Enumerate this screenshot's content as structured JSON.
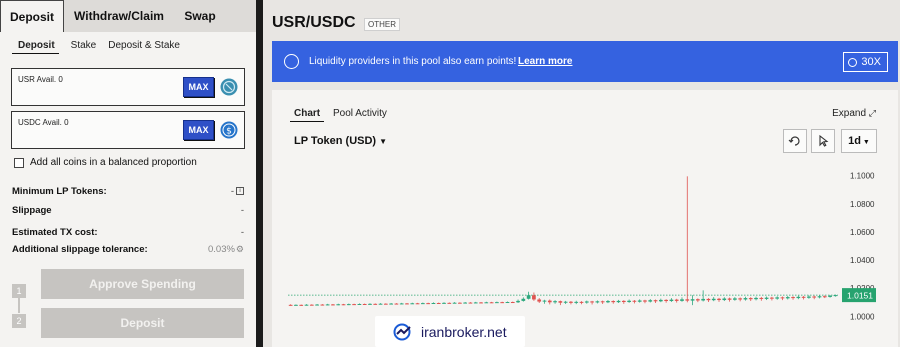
{
  "tabs": [
    "Deposit",
    "Withdraw/Claim",
    "Swap"
  ],
  "subtabs": [
    "Deposit",
    "Stake",
    "Deposit & Stake"
  ],
  "inputs": [
    {
      "label": "USR Avail. 0",
      "max": "MAX",
      "coin": "usr-coin-icon"
    },
    {
      "label": "USDC Avail. 0",
      "max": "MAX",
      "coin": "usdc-coin-icon"
    }
  ],
  "balanced_label": "Add all coins in a balanced proportion",
  "rows": {
    "min_lp": {
      "label": "Minimum LP Tokens:",
      "value": "-"
    },
    "slippage": {
      "label": "Slippage",
      "value": "-"
    },
    "tx_cost": {
      "label": "Estimated TX cost:",
      "value": "-"
    },
    "add_slip": {
      "label": "Additional slippage tolerance:",
      "value": "0.03%"
    }
  },
  "steps": [
    "1",
    "2"
  ],
  "buttons": {
    "approve": "Approve Spending",
    "deposit": "Deposit"
  },
  "pool": {
    "name": "USR/USDC",
    "tag": "OTHER"
  },
  "banner": {
    "text": "Liquidity providers in this pool also earn points!",
    "link": "Learn more",
    "multiplier": "30X"
  },
  "chart_panel": {
    "tabs": [
      "Chart",
      "Pool Activity"
    ],
    "expand": "Expand",
    "token": "LP Token (USD)",
    "timeframe": "1d"
  },
  "watermark": "iranbroker.net",
  "colors": {
    "up": "#2ea87e",
    "down": "#e0524f",
    "accent": "#3562e0",
    "current": "#27a36f"
  },
  "chart_data": {
    "type": "candlestick",
    "yticks": [
      "1.1000",
      "1.0800",
      "1.0600",
      "1.0400",
      "1.0200",
      "1.0000"
    ],
    "ylim": [
      0.996,
      1.104
    ],
    "current_value": "1.0151",
    "grid": false,
    "spike_high": 1.0995,
    "candles": [
      {
        "o": 1.0082,
        "c": 1.008,
        "h": 1.0086,
        "l": 1.0076
      },
      {
        "o": 1.008,
        "c": 1.0082,
        "h": 1.0085,
        "l": 1.0077
      },
      {
        "o": 1.0082,
        "c": 1.0079,
        "h": 1.0084,
        "l": 1.0075
      },
      {
        "o": 1.0079,
        "c": 1.0083,
        "h": 1.0087,
        "l": 1.0076
      },
      {
        "o": 1.0083,
        "c": 1.008,
        "h": 1.0086,
        "l": 1.0077
      },
      {
        "o": 1.008,
        "c": 1.0084,
        "h": 1.0088,
        "l": 1.0078
      },
      {
        "o": 1.0084,
        "c": 1.0081,
        "h": 1.0087,
        "l": 1.0077
      },
      {
        "o": 1.0081,
        "c": 1.0085,
        "h": 1.0089,
        "l": 1.0079
      },
      {
        "o": 1.0085,
        "c": 1.0082,
        "h": 1.0088,
        "l": 1.0078
      },
      {
        "o": 1.0082,
        "c": 1.0086,
        "h": 1.009,
        "l": 1.0079
      },
      {
        "o": 1.0086,
        "c": 1.0083,
        "h": 1.0089,
        "l": 1.008
      },
      {
        "o": 1.0083,
        "c": 1.0087,
        "h": 1.0091,
        "l": 1.008
      },
      {
        "o": 1.0087,
        "c": 1.0084,
        "h": 1.009,
        "l": 1.0081
      },
      {
        "o": 1.0084,
        "c": 1.0088,
        "h": 1.0092,
        "l": 1.0082
      },
      {
        "o": 1.0088,
        "c": 1.0085,
        "h": 1.0091,
        "l": 1.0082
      },
      {
        "o": 1.0085,
        "c": 1.0089,
        "h": 1.0093,
        "l": 1.0083
      },
      {
        "o": 1.0089,
        "c": 1.0086,
        "h": 1.0092,
        "l": 1.0083
      },
      {
        "o": 1.0086,
        "c": 1.009,
        "h": 1.0094,
        "l": 1.0084
      },
      {
        "o": 1.009,
        "c": 1.0087,
        "h": 1.0093,
        "l": 1.0085
      },
      {
        "o": 1.0087,
        "c": 1.0091,
        "h": 1.0095,
        "l": 1.0085
      },
      {
        "o": 1.0091,
        "c": 1.0088,
        "h": 1.0094,
        "l": 1.0086
      },
      {
        "o": 1.0088,
        "c": 1.0092,
        "h": 1.0096,
        "l": 1.0086
      },
      {
        "o": 1.0092,
        "c": 1.009,
        "h": 1.0095,
        "l": 1.0087
      },
      {
        "o": 1.009,
        "c": 1.0093,
        "h": 1.0097,
        "l": 1.0088
      },
      {
        "o": 1.0093,
        "c": 1.0091,
        "h": 1.0096,
        "l": 1.0088
      },
      {
        "o": 1.0091,
        "c": 1.0094,
        "h": 1.0098,
        "l": 1.0089
      },
      {
        "o": 1.0094,
        "c": 1.0092,
        "h": 1.0097,
        "l": 1.009
      },
      {
        "o": 1.0092,
        "c": 1.0095,
        "h": 1.0099,
        "l": 1.009
      },
      {
        "o": 1.0095,
        "c": 1.0093,
        "h": 1.0098,
        "l": 1.0091
      },
      {
        "o": 1.0093,
        "c": 1.0096,
        "h": 1.01,
        "l": 1.0091
      },
      {
        "o": 1.0096,
        "c": 1.0094,
        "h": 1.0099,
        "l": 1.0092
      },
      {
        "o": 1.0094,
        "c": 1.0097,
        "h": 1.0101,
        "l": 1.0092
      },
      {
        "o": 1.0097,
        "c": 1.0095,
        "h": 1.01,
        "l": 1.0093
      },
      {
        "o": 1.0095,
        "c": 1.0098,
        "h": 1.0102,
        "l": 1.0093
      },
      {
        "o": 1.0098,
        "c": 1.0096,
        "h": 1.0101,
        "l": 1.0094
      },
      {
        "o": 1.0096,
        "c": 1.0099,
        "h": 1.0103,
        "l": 1.0094
      },
      {
        "o": 1.0099,
        "c": 1.0097,
        "h": 1.0102,
        "l": 1.0095
      },
      {
        "o": 1.0097,
        "c": 1.01,
        "h": 1.0104,
        "l": 1.0095
      },
      {
        "o": 1.01,
        "c": 1.0098,
        "h": 1.0103,
        "l": 1.0096
      },
      {
        "o": 1.0098,
        "c": 1.0101,
        "h": 1.0105,
        "l": 1.0096
      },
      {
        "o": 1.0101,
        "c": 1.0099,
        "h": 1.0104,
        "l": 1.0097
      },
      {
        "o": 1.0099,
        "c": 1.0102,
        "h": 1.0106,
        "l": 1.0097
      },
      {
        "o": 1.0102,
        "c": 1.01,
        "h": 1.0105,
        "l": 1.0098
      },
      {
        "o": 1.01,
        "c": 1.011,
        "h": 1.012,
        "l": 1.0095
      },
      {
        "o": 1.011,
        "c": 1.0125,
        "h": 1.0135,
        "l": 1.0105
      },
      {
        "o": 1.0125,
        "c": 1.015,
        "h": 1.0175,
        "l": 1.012
      },
      {
        "o": 1.015,
        "c": 1.012,
        "h": 1.017,
        "l": 1.011
      },
      {
        "o": 1.012,
        "c": 1.0105,
        "h": 1.013,
        "l": 1.0095
      },
      {
        "o": 1.0105,
        "c": 1.0112,
        "h": 1.0118,
        "l": 1.009
      },
      {
        "o": 1.0112,
        "c": 1.01,
        "h": 1.012,
        "l": 1.0085
      },
      {
        "o": 1.01,
        "c": 1.0108,
        "h": 1.0115,
        "l": 1.009
      },
      {
        "o": 1.0108,
        "c": 1.0097,
        "h": 1.0112,
        "l": 1.008
      },
      {
        "o": 1.0097,
        "c": 1.0104,
        "h": 1.011,
        "l": 1.0088
      },
      {
        "o": 1.0104,
        "c": 1.0096,
        "h": 1.0109,
        "l": 1.0085
      },
      {
        "o": 1.0096,
        "c": 1.0103,
        "h": 1.0111,
        "l": 1.0087
      },
      {
        "o": 1.0103,
        "c": 1.0098,
        "h": 1.0108,
        "l": 1.0086
      },
      {
        "o": 1.0098,
        "c": 1.0106,
        "h": 1.0112,
        "l": 1.009
      },
      {
        "o": 1.0106,
        "c": 1.0099,
        "h": 1.011,
        "l": 1.0084
      },
      {
        "o": 1.0099,
        "c": 1.0107,
        "h": 1.0113,
        "l": 1.0092
      },
      {
        "o": 1.0107,
        "c": 1.01,
        "h": 1.0112,
        "l": 1.0088
      },
      {
        "o": 1.01,
        "c": 1.0109,
        "h": 1.0116,
        "l": 1.0094
      },
      {
        "o": 1.0109,
        "c": 1.0101,
        "h": 1.0114,
        "l": 1.009
      },
      {
        "o": 1.0101,
        "c": 1.011,
        "h": 1.0117,
        "l": 1.0095
      },
      {
        "o": 1.011,
        "c": 1.0102,
        "h": 1.0115,
        "l": 1.0089
      },
      {
        "o": 1.0102,
        "c": 1.0111,
        "h": 1.012,
        "l": 1.0096
      },
      {
        "o": 1.0111,
        "c": 1.0104,
        "h": 1.0116,
        "l": 1.0092
      },
      {
        "o": 1.0104,
        "c": 1.0113,
        "h": 1.0121,
        "l": 1.0098
      },
      {
        "o": 1.0113,
        "c": 1.0105,
        "h": 1.0118,
        "l": 1.0093
      },
      {
        "o": 1.0105,
        "c": 1.0115,
        "h": 1.0123,
        "l": 1.0099
      },
      {
        "o": 1.0115,
        "c": 1.0107,
        "h": 1.012,
        "l": 1.0095
      },
      {
        "o": 1.0107,
        "c": 1.0117,
        "h": 1.0126,
        "l": 1.0101
      },
      {
        "o": 1.0117,
        "c": 1.0109,
        "h": 1.0122,
        "l": 1.0097
      },
      {
        "o": 1.0109,
        "c": 1.0119,
        "h": 1.013,
        "l": 1.0103
      },
      {
        "o": 1.0119,
        "c": 1.011,
        "h": 1.0125,
        "l": 1.0098
      },
      {
        "o": 1.011,
        "c": 1.0121,
        "h": 1.0135,
        "l": 1.0104
      },
      {
        "o": 1.0121,
        "c": 1.0112,
        "h": 1.0995,
        "l": 1.01
      },
      {
        "o": 1.0112,
        "c": 1.0122,
        "h": 1.015,
        "l": 1.008
      },
      {
        "o": 1.0122,
        "c": 1.0113,
        "h": 1.0128,
        "l": 1.0101
      },
      {
        "o": 1.0113,
        "c": 1.0124,
        "h": 1.0185,
        "l": 1.0106
      },
      {
        "o": 1.0124,
        "c": 1.0115,
        "h": 1.013,
        "l": 1.0102
      },
      {
        "o": 1.0115,
        "c": 1.0125,
        "h": 1.0137,
        "l": 1.0108
      },
      {
        "o": 1.0125,
        "c": 1.0116,
        "h": 1.0131,
        "l": 1.0103
      },
      {
        "o": 1.0116,
        "c": 1.0127,
        "h": 1.0136,
        "l": 1.0109
      },
      {
        "o": 1.0127,
        "c": 1.0118,
        "h": 1.0133,
        "l": 1.0105
      },
      {
        "o": 1.0118,
        "c": 1.0128,
        "h": 1.0137,
        "l": 1.0111
      },
      {
        "o": 1.0128,
        "c": 1.012,
        "h": 1.0134,
        "l": 1.0107
      },
      {
        "o": 1.012,
        "c": 1.013,
        "h": 1.0139,
        "l": 1.0112
      },
      {
        "o": 1.013,
        "c": 1.0122,
        "h": 1.0136,
        "l": 1.0109
      },
      {
        "o": 1.0122,
        "c": 1.0131,
        "h": 1.014,
        "l": 1.0114
      },
      {
        "o": 1.0131,
        "c": 1.0124,
        "h": 1.0138,
        "l": 1.0111
      },
      {
        "o": 1.0124,
        "c": 1.0133,
        "h": 1.0141,
        "l": 1.0116
      },
      {
        "o": 1.0133,
        "c": 1.0126,
        "h": 1.0139,
        "l": 1.0113
      },
      {
        "o": 1.0126,
        "c": 1.0135,
        "h": 1.0143,
        "l": 1.0118
      },
      {
        "o": 1.0135,
        "c": 1.0128,
        "h": 1.0141,
        "l": 1.0115
      },
      {
        "o": 1.0128,
        "c": 1.0137,
        "h": 1.0145,
        "l": 1.012
      },
      {
        "o": 1.0137,
        "c": 1.013,
        "h": 1.0143,
        "l": 1.0118
      },
      {
        "o": 1.013,
        "c": 1.0139,
        "h": 1.0147,
        "l": 1.0122
      },
      {
        "o": 1.0139,
        "c": 1.0132,
        "h": 1.0145,
        "l": 1.012
      },
      {
        "o": 1.0132,
        "c": 1.0141,
        "h": 1.0149,
        "l": 1.0125
      },
      {
        "o": 1.0141,
        "c": 1.0135,
        "h": 1.0147,
        "l": 1.0122
      },
      {
        "o": 1.0135,
        "c": 1.0143,
        "h": 1.0151,
        "l": 1.0128
      },
      {
        "o": 1.0143,
        "c": 1.0138,
        "h": 1.0149,
        "l": 1.013
      },
      {
        "o": 1.0138,
        "c": 1.0146,
        "h": 1.0152,
        "l": 1.0133
      },
      {
        "o": 1.0146,
        "c": 1.0151,
        "h": 1.0155,
        "l": 1.014
      }
    ]
  }
}
